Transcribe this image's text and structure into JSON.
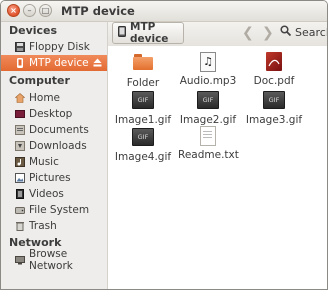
{
  "window": {
    "title": "MTP device"
  },
  "sidebar": {
    "devices_heading": "Devices",
    "devices": [
      {
        "label": "Floppy Disk",
        "icon": "floppy-icon"
      },
      {
        "label": "MTP device",
        "icon": "mtp-device-icon",
        "active": true
      }
    ],
    "computer_heading": "Computer",
    "computer": [
      {
        "label": "Home",
        "icon": "home-icon"
      },
      {
        "label": "Desktop",
        "icon": "desktop-icon"
      },
      {
        "label": "Documents",
        "icon": "documents-icon"
      },
      {
        "label": "Downloads",
        "icon": "downloads-icon"
      },
      {
        "label": "Music",
        "icon": "music-icon"
      },
      {
        "label": "Pictures",
        "icon": "pictures-icon"
      },
      {
        "label": "Videos",
        "icon": "videos-icon"
      },
      {
        "label": "File System",
        "icon": "file-system-icon"
      },
      {
        "label": "Trash",
        "icon": "trash-icon"
      }
    ],
    "network_heading": "Network",
    "network": [
      {
        "label": "Browse Network",
        "icon": "network-icon"
      }
    ]
  },
  "toolbar": {
    "path_label": "MTP device",
    "back_glyph": "❮",
    "forward_glyph": "❯",
    "search_label": "Search"
  },
  "files": [
    {
      "name": "Folder",
      "type": "folder"
    },
    {
      "name": "Audio.mp3",
      "type": "audio"
    },
    {
      "name": "Doc.pdf",
      "type": "pdf"
    },
    {
      "name": "Image1.gif",
      "type": "gif",
      "badge": "GIF"
    },
    {
      "name": "Image2.gif",
      "type": "gif",
      "badge": "GIF"
    },
    {
      "name": "Image3.gif",
      "type": "gif",
      "badge": "GIF"
    },
    {
      "name": "Image4.gif",
      "type": "gif",
      "badge": "GIF"
    },
    {
      "name": "Readme.txt",
      "type": "text"
    }
  ],
  "colors": {
    "accent": "#e36a32",
    "sidebar_bg": "#eeedeb"
  }
}
